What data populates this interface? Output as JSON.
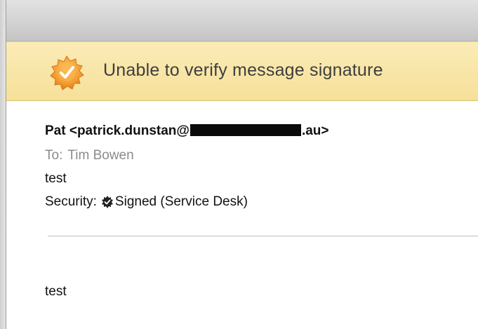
{
  "banner": {
    "message": "Unable to verify message signature",
    "icon": "warning-seal-icon",
    "background_color": "#f7e3a0",
    "icon_color": "#f2a13a"
  },
  "message_header": {
    "from_prefix": "Pat <patrick.dunstan@",
    "from_suffix": ".au>",
    "to_label": "To:",
    "to_value": "Tim Bowen",
    "subject": "test",
    "security_label": "Security:",
    "security_value": "Signed (Service Desk)",
    "security_icon": "signed-seal-icon"
  },
  "message_body": {
    "text": "test"
  }
}
